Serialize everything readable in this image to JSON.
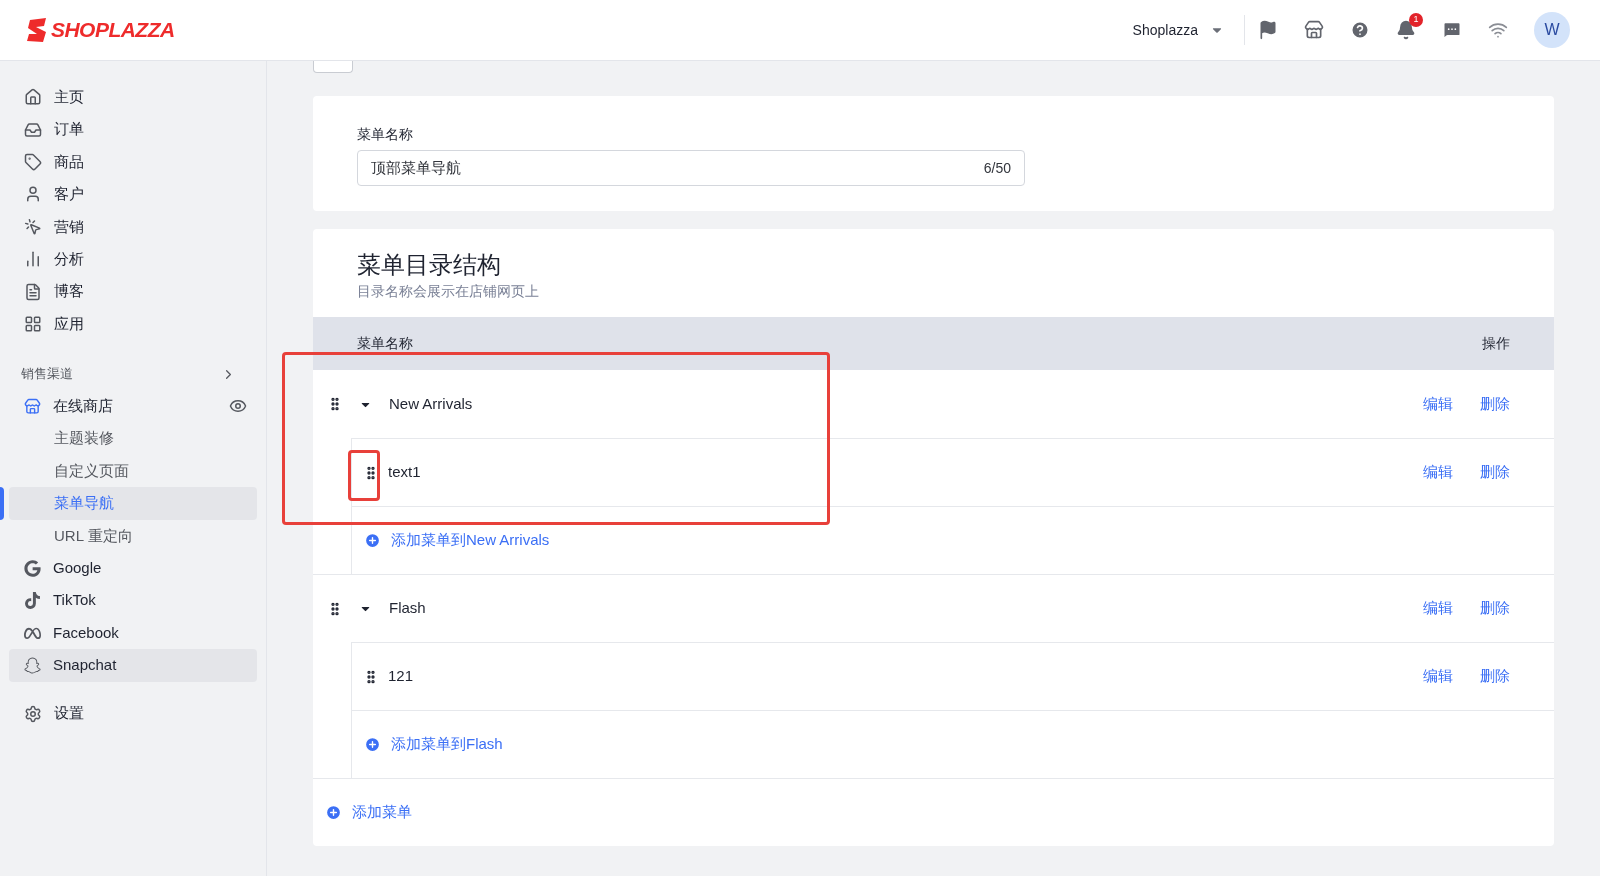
{
  "header": {
    "logo": "SHOPLAZZA",
    "store_switcher": "Shoplazza",
    "notification_count": "1",
    "avatar": "W"
  },
  "sidebar": {
    "items": [
      {
        "label": "主页"
      },
      {
        "label": "订单"
      },
      {
        "label": "商品"
      },
      {
        "label": "客户"
      },
      {
        "label": "营销"
      },
      {
        "label": "分析"
      },
      {
        "label": "博客"
      },
      {
        "label": "应用"
      }
    ],
    "channels_title": "销售渠道",
    "channels": [
      {
        "label": "在线商店",
        "highlighted": false,
        "children": [
          {
            "label": "主题装修",
            "selected": false
          },
          {
            "label": "自定义页面",
            "selected": false
          },
          {
            "label": "菜单导航",
            "selected": true
          },
          {
            "label": "URL 重定向",
            "selected": false
          }
        ]
      },
      {
        "label": "Google",
        "highlighted": false
      },
      {
        "label": "TikTok",
        "highlighted": false
      },
      {
        "label": "Facebook",
        "highlighted": false
      },
      {
        "label": "Snapchat",
        "highlighted": true
      }
    ],
    "settings": "设置"
  },
  "menu_form": {
    "name_label": "菜单名称",
    "name_value": "顶部菜单导航",
    "name_count": "6/50"
  },
  "structure": {
    "title": "菜单目录结构",
    "subtitle": "目录名称会展示在店铺网页上",
    "columns": [
      "菜单名称",
      "操作"
    ],
    "items": [
      {
        "label": "New Arrivals",
        "expanded": true,
        "actions": [
          "编辑",
          "删除"
        ],
        "children": [
          {
            "label": "text1",
            "actions": [
              "编辑",
              "删除"
            ]
          }
        ],
        "add_child": "添加菜单到New Arrivals"
      },
      {
        "label": "Flash",
        "expanded": true,
        "actions": [
          "编辑",
          "删除"
        ],
        "children": [
          {
            "label": "121",
            "actions": [
              "编辑",
              "删除"
            ]
          }
        ],
        "add_child": "添加菜单到Flash"
      }
    ],
    "add_menu": "添加菜单"
  }
}
